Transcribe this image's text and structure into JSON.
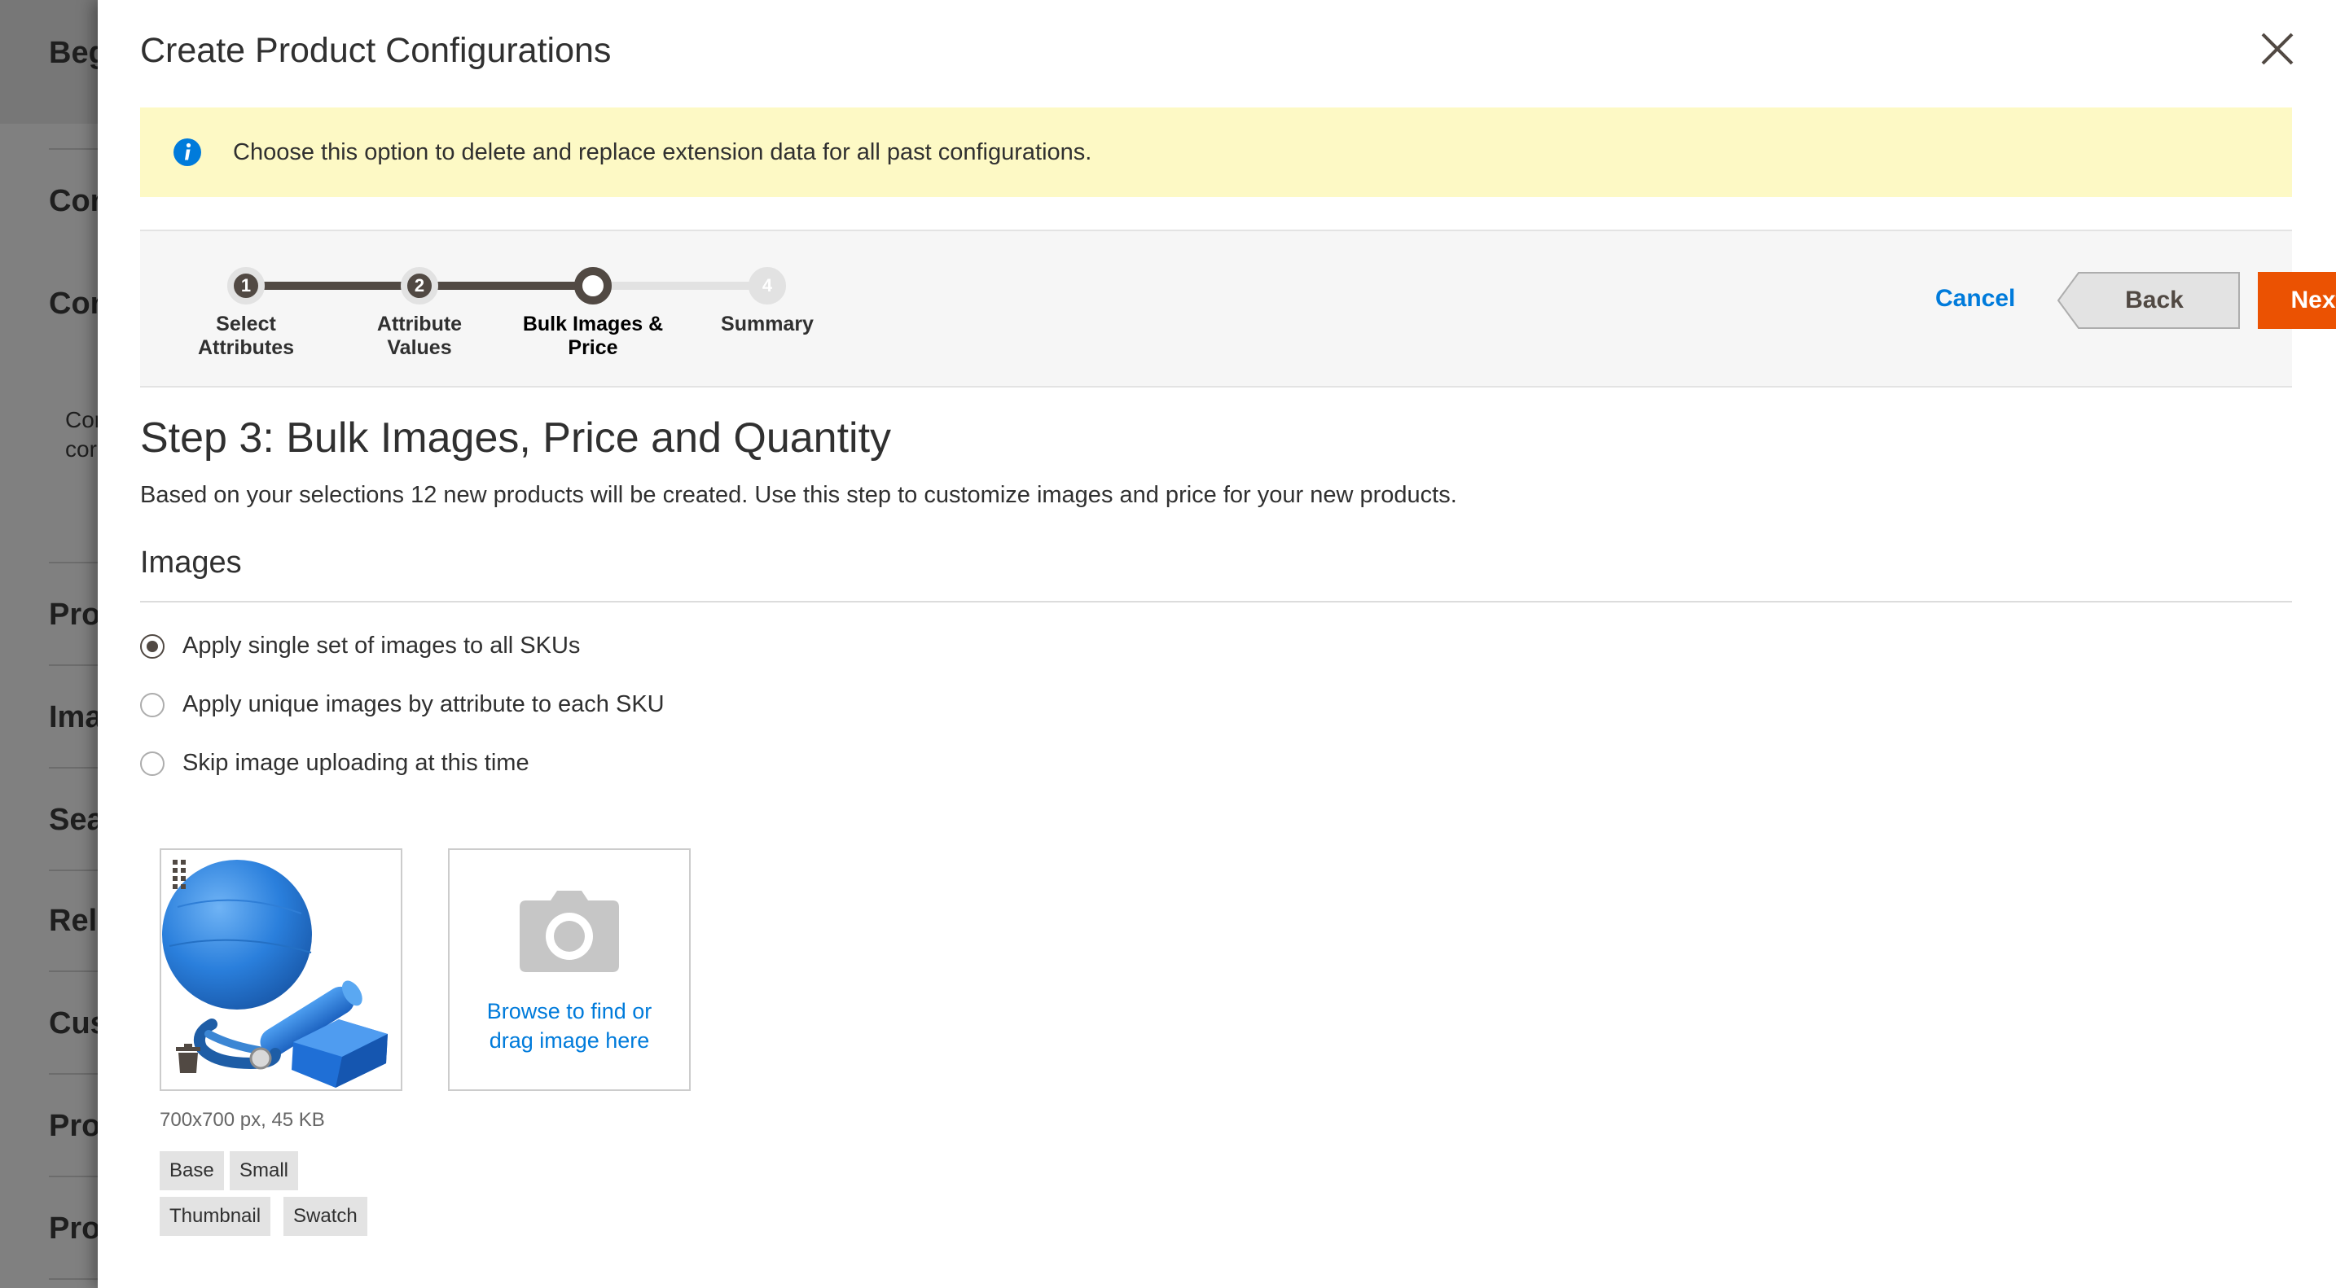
{
  "background": {
    "items": [
      "Beg",
      "Con",
      "Con",
      "Pro",
      "Ima",
      "Sea",
      "Rel",
      "Cus",
      "Pro",
      "Pro"
    ],
    "note_lines": [
      "Cor",
      "cor"
    ]
  },
  "modal": {
    "title": "Create Product Configurations",
    "close_icon": "close-icon"
  },
  "notice": {
    "icon": "info-icon",
    "text": "Choose this option to delete and replace extension data for all past configurations.",
    "color": "#fdf9c5"
  },
  "wizard": {
    "steps": [
      {
        "number": "1",
        "label_line1": "Select",
        "label_line2": "Attributes",
        "state": "done"
      },
      {
        "number": "2",
        "label_line1": "Attribute",
        "label_line2": "Values",
        "state": "done"
      },
      {
        "number": "3",
        "label_line1": "Bulk Images &",
        "label_line2": "Price",
        "state": "current"
      },
      {
        "number": "4",
        "label_line1": "Summary",
        "label_line2": "",
        "state": "todo"
      }
    ],
    "cancel_label": "Cancel",
    "back_label": "Back",
    "next_label": "Next",
    "accent_color": "#eb5202",
    "link_color": "#007bdb"
  },
  "content": {
    "step_title": "Step 3: Bulk Images, Price and Quantity",
    "step_description": "Based on your selections 12 new products will be created. Use this step to customize images and price for your new products.",
    "images_section": {
      "title": "Images",
      "options": [
        {
          "label": "Apply single set of images to all SKUs",
          "checked": true
        },
        {
          "label": "Apply unique images by attribute to each SKU",
          "checked": false
        },
        {
          "label": "Skip image uploading at this time",
          "checked": false
        }
      ],
      "uploaded_image": {
        "meta": "700x700 px, 45 KB",
        "roles": [
          "Base",
          "Small",
          "Thumbnail",
          "Swatch"
        ]
      },
      "upload_prompt_line1": "Browse to find or",
      "upload_prompt_line2": "drag image here"
    }
  }
}
